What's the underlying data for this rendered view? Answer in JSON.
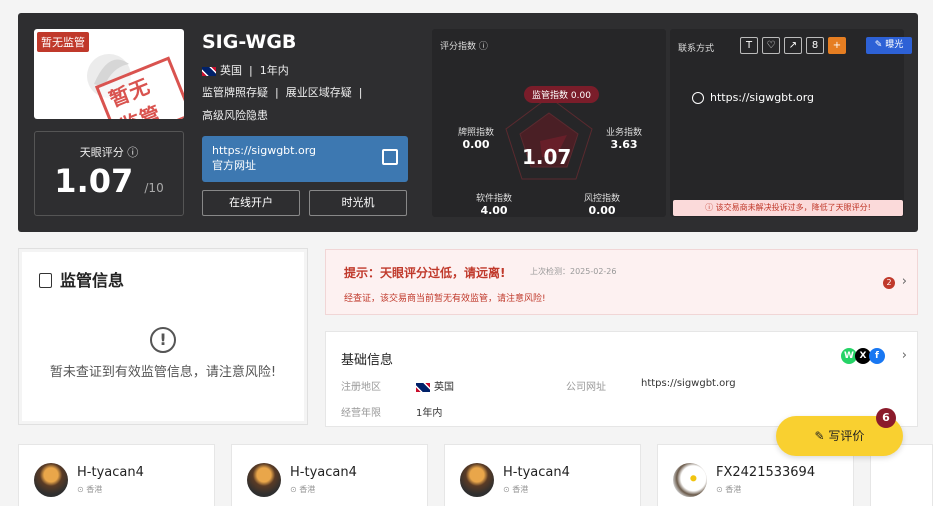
{
  "broker": {
    "logo_tag": "暂无监管",
    "stamp": "暂无监管",
    "name": "SIG-WGB",
    "country": "英国",
    "years": "1年内",
    "tags_line1": [
      "监管牌照存疑",
      "展业区域存疑"
    ],
    "tags_line2": "高级风险隐患",
    "score_label": "天眼评分",
    "score": "1.07",
    "score_max": "/10",
    "site_url": "https://sigwgbt.org",
    "site_label": "官方网址",
    "btn_open": "在线开户",
    "btn_timemachine": "时光机"
  },
  "radar": {
    "title": "评分指数",
    "center": "1.07",
    "top_label": "监管指数",
    "top_value": "0.00",
    "license_label": "牌照指数",
    "license_value": "0.00",
    "business_label": "业务指数",
    "business_value": "3.63",
    "software_label": "软件指数",
    "software_value": "4.00",
    "risk_label": "风控指数",
    "risk_value": "0.00"
  },
  "contact": {
    "title": "联系方式",
    "icons": [
      "T",
      "♡",
      "↗",
      "8",
      "+"
    ],
    "expose": "曝光",
    "url": "https://sigwgbt.org",
    "warning": "该交易商未解决投诉过多，降低了天眼评分!"
  },
  "regulation": {
    "title": "监管信息",
    "message": "暂未查证到有效监管信息，请注意风险!"
  },
  "notice": {
    "title": "提示：天眼评分过低，请远离!",
    "date": "上次检测：2025-02-26",
    "message": "经查证，该交易商当前暂无有效监管，请注意风险!",
    "count": "2"
  },
  "basic": {
    "title": "基础信息",
    "region_label": "注册地区",
    "region_value": "英国",
    "site_label": "公司网址",
    "site_value": "https://sigwgbt.org",
    "years_label": "经营年限",
    "years_value": "1年内",
    "social": [
      "W",
      "X",
      "f"
    ]
  },
  "review_button": {
    "label": "写评价",
    "count": "6"
  },
  "reviews": [
    {
      "name": "H-tyacan4",
      "location": "香港"
    },
    {
      "name": "H-tyacan4",
      "location": "香港"
    },
    {
      "name": "H-tyacan4",
      "location": "香港"
    },
    {
      "name": "FX2421533694",
      "location": "香港"
    }
  ],
  "colors": {
    "accent_red": "#c0392b",
    "blue_button": "#3d78b1",
    "yellow_button": "#f9d030"
  }
}
